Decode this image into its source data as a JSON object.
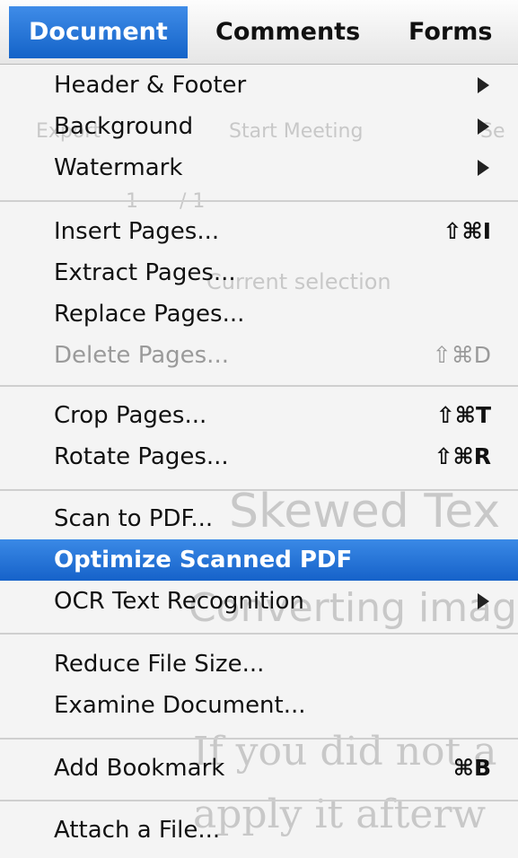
{
  "menubar": {
    "items": [
      {
        "label": "Document",
        "active": true
      },
      {
        "label": "Comments",
        "active": false
      },
      {
        "label": "Forms",
        "active": false
      }
    ]
  },
  "background": {
    "toolbar_meeting": "Start Meeting",
    "toolbar_sec": "Se",
    "export_text": "Export",
    "page_current": "1",
    "page_total": "/ 1",
    "current_selection": "Current selection",
    "doc_heading": "Skewed Tex",
    "doc_subheading": "Converting image",
    "doc_line1": "If you did not a",
    "doc_line2": "apply it afterw"
  },
  "menu": {
    "groups": [
      {
        "items": [
          {
            "label": "Header & Footer",
            "submenu": true
          },
          {
            "label": "Background",
            "submenu": true
          },
          {
            "label": "Watermark",
            "submenu": true
          }
        ]
      },
      {
        "items": [
          {
            "label": "Insert Pages...",
            "shortcut": "⇧⌘I"
          },
          {
            "label": "Extract Pages..."
          },
          {
            "label": "Replace Pages..."
          },
          {
            "label": "Delete Pages...",
            "shortcut": "⇧⌘D",
            "disabled": true
          }
        ]
      },
      {
        "items": [
          {
            "label": "Crop Pages...",
            "shortcut": "⇧⌘T"
          },
          {
            "label": "Rotate Pages...",
            "shortcut": "⇧⌘R"
          }
        ]
      },
      {
        "items": [
          {
            "label": "Scan to PDF..."
          },
          {
            "label": "Optimize Scanned PDF",
            "highlighted": true
          },
          {
            "label": "OCR Text Recognition",
            "submenu": true
          }
        ]
      },
      {
        "items": [
          {
            "label": "Reduce File Size..."
          },
          {
            "label": "Examine Document..."
          }
        ]
      },
      {
        "items": [
          {
            "label": "Add Bookmark",
            "shortcut": "⌘B"
          }
        ]
      },
      {
        "items": [
          {
            "label": "Attach a File..."
          }
        ]
      }
    ]
  },
  "colors": {
    "highlight": "#1a6fd8",
    "text": "#111111",
    "disabled_text": "#9a9a9a",
    "ghost_text": "#c8c8c8"
  },
  "icons": {
    "submenu": "right-triangle-arrow",
    "shift": "shift-symbol",
    "command": "command-symbol"
  }
}
